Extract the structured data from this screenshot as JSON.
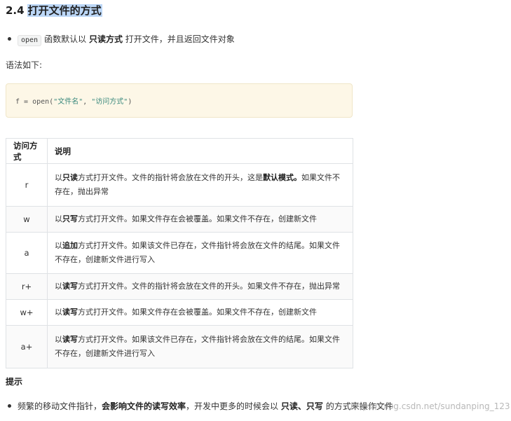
{
  "heading": {
    "number": "2.4",
    "title": "打开文件的方式"
  },
  "intro": {
    "code": "open",
    "text_before_bold": "函数默认以",
    "bold": "只读方式",
    "text_after_bold": "打开文件，并且返回文件对象"
  },
  "syntax_label": "语法如下:",
  "code_example": {
    "prefix": "f = open(",
    "arg1": "\"文件名\"",
    "sep": ", ",
    "arg2": "\"访问方式\"",
    "suffix": ")"
  },
  "table": {
    "headers": [
      "访问方式",
      "说明"
    ],
    "rows": [
      {
        "mode": "r",
        "pre": "以",
        "bold": "只读",
        "mid": "方式打开文件。文件的指针将会放在文件的开头，这是",
        "bold2": "默认模式。",
        "post": "如果文件不存在，抛出异常"
      },
      {
        "mode": "w",
        "pre": "以",
        "bold": "只写",
        "mid": "方式打开文件。如果文件存在会被覆盖。如果文件不存在，创建新文件",
        "bold2": "",
        "post": ""
      },
      {
        "mode": "a",
        "pre": "以",
        "bold": "追加",
        "mid": "方式打开文件。如果该文件已存在，文件指针将会放在文件的结尾。如果文件不存在，创建新文件进行写入",
        "bold2": "",
        "post": ""
      },
      {
        "mode": "r+",
        "pre": "以",
        "bold": "读写",
        "mid": "方式打开文件。文件的指针将会放在文件的开头。如果文件不存在，抛出异常",
        "bold2": "",
        "post": ""
      },
      {
        "mode": "w+",
        "pre": "以",
        "bold": "读写",
        "mid": "方式打开文件。如果文件存在会被覆盖。如果文件不存在，创建新文件",
        "bold2": "",
        "post": ""
      },
      {
        "mode": "a+",
        "pre": "以",
        "bold": "读写",
        "mid": "方式打开文件。如果该文件已存在，文件指针将会放在文件的结尾。如果文件不存在，创建新文件进行写入",
        "bold2": "",
        "post": ""
      }
    ]
  },
  "tip": {
    "label": "提示",
    "text_before": "频繁的移动文件指针，",
    "bold1": "会影响文件的读写效率",
    "text_mid": "，开发中更多的时候会以",
    "bold2": "只读、只写",
    "text_after": "的方式来操作文件"
  },
  "watermark": "https://blog.csdn.net/sundanping_123"
}
